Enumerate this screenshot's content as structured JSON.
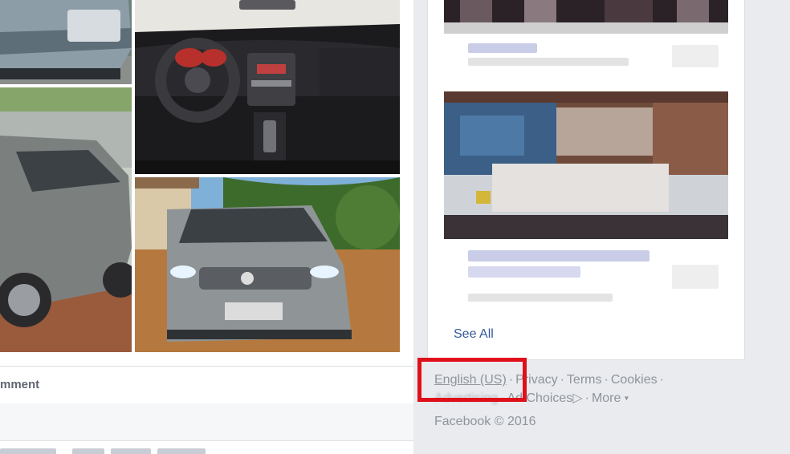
{
  "post": {
    "comment_label": "mment"
  },
  "sidebar": {
    "see_all": "See All"
  },
  "footer": {
    "language": "English (US)",
    "privacy": "Privacy",
    "terms": "Terms",
    "cookies": "Cookies",
    "advertising": "Advertising",
    "ad_choices": "Ad Choices",
    "more": "More",
    "copyright": "Facebook © 2016"
  },
  "colors": {
    "link_blue": "#365899",
    "footer_gray": "#90949c",
    "highlight_red": "#e0101a"
  }
}
